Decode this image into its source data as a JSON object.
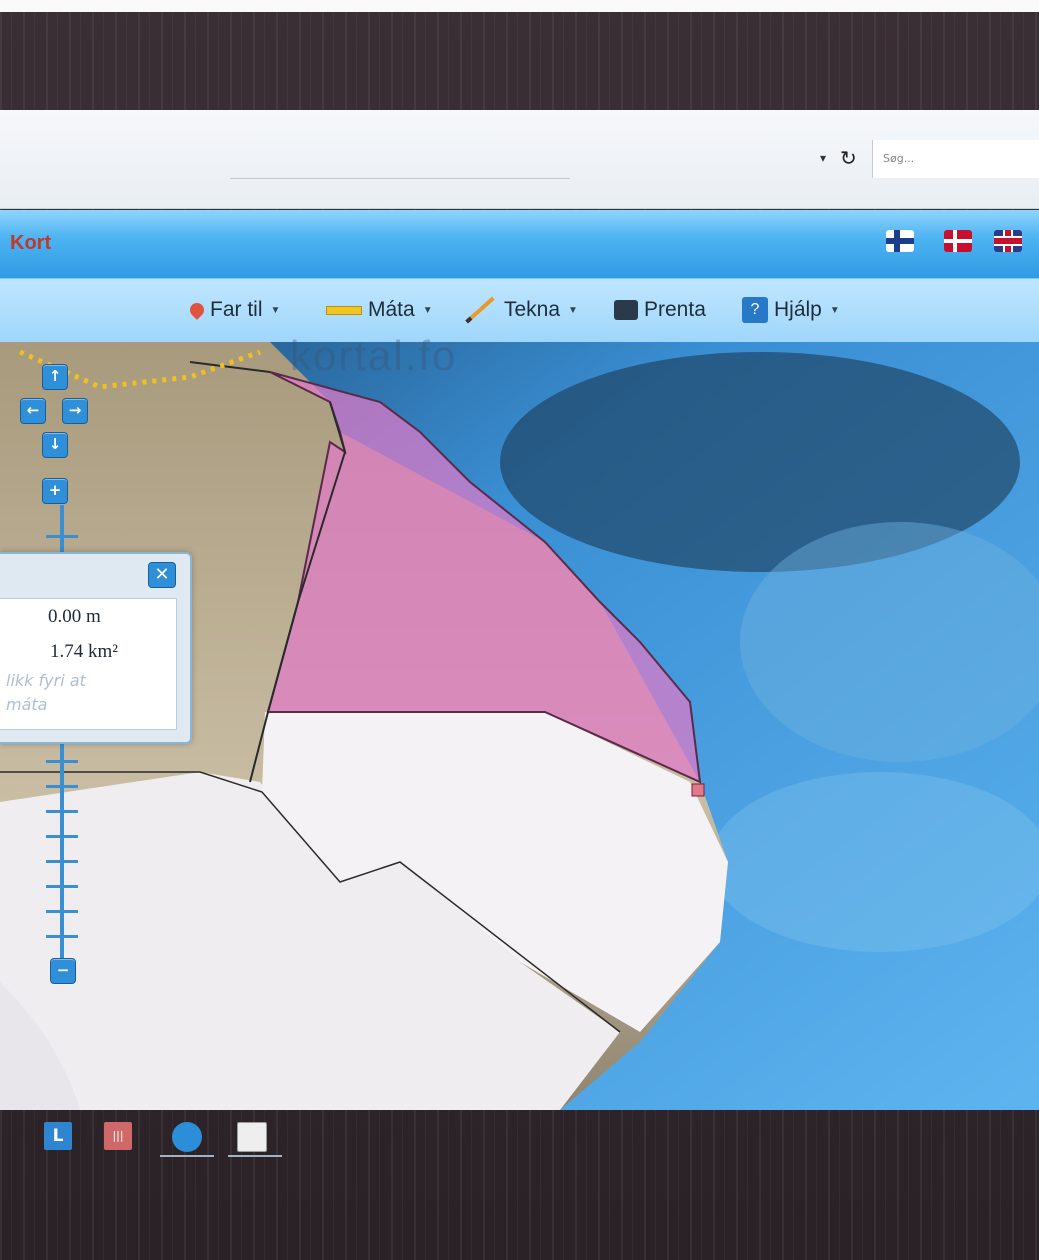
{
  "browser": {
    "search_placeholder": "Søg..."
  },
  "app": {
    "title": "Kort",
    "languages": [
      "faroese-flag",
      "danish-flag",
      "uk-flag"
    ]
  },
  "toolbar": {
    "items": [
      {
        "label": "Far til",
        "icon": "pin-icon",
        "has_dropdown": true
      },
      {
        "label": "Máta",
        "icon": "ruler-icon",
        "has_dropdown": true
      },
      {
        "label": "Tekna",
        "icon": "pencil-icon",
        "has_dropdown": true
      },
      {
        "label": "Prenta",
        "icon": "printer-icon",
        "has_dropdown": false
      },
      {
        "label": "Hjálp",
        "icon": "help-icon",
        "has_dropdown": true
      }
    ]
  },
  "map": {
    "watermark": "kortal.fo",
    "colors": {
      "sea": "#3a9be0",
      "land": "#c9b89a",
      "snow": "#f0eef0",
      "measured_area": "#e07ac8"
    }
  },
  "measure": {
    "length": "0.00 m",
    "area": "1.74 km²",
    "hint_line1": "likk fyri at",
    "hint_line2": "máta"
  },
  "taskbar": {
    "icons": [
      "app-l-icon",
      "red-app-icon",
      "globe-icon",
      "photo-icon"
    ]
  }
}
